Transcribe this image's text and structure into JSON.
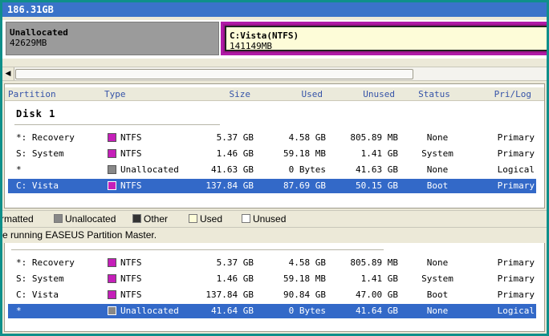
{
  "disk_map": {
    "capacity": "186.31GB",
    "segments": [
      {
        "name": "Unallocated",
        "size": "42629MB"
      },
      {
        "name": "C:Vista(NTFS)",
        "size": "141149MB"
      }
    ]
  },
  "table": {
    "columns": [
      "Partition",
      "Type",
      "Size",
      "Used",
      "Unused",
      "Status",
      "Pri/Log"
    ],
    "disk_label": "Disk 1",
    "rows": [
      {
        "partition": "*: Recovery",
        "type": "NTFS",
        "size": "5.37 GB",
        "used": "4.58 GB",
        "unused": "805.89 MB",
        "status": "None",
        "prilog": "Primary",
        "color": "#c51fb9"
      },
      {
        "partition": "S: System",
        "type": "NTFS",
        "size": "1.46 GB",
        "used": "59.18 MB",
        "unused": "1.41 GB",
        "status": "System",
        "prilog": "Primary",
        "color": "#c51fb9"
      },
      {
        "partition": "*",
        "type": "Unallocated",
        "size": "41.63 GB",
        "used": "0 Bytes",
        "unused": "41.63 GB",
        "status": "None",
        "prilog": "Logical",
        "color": "#888888"
      },
      {
        "partition": "C: Vista",
        "type": "NTFS",
        "size": "137.84 GB",
        "used": "87.69 GB",
        "unused": "50.15 GB",
        "status": "Boot",
        "prilog": "Primary",
        "color": "#c51fb9"
      }
    ]
  },
  "legend": {
    "items": [
      {
        "label": "rmatted",
        "color": ""
      },
      {
        "label": "Unallocated",
        "color": "#888888"
      },
      {
        "label": "Other",
        "color": "#333333"
      },
      {
        "label": "Used",
        "color": "#fdfcd8"
      },
      {
        "label": "Unused",
        "color": "#ffffff"
      }
    ]
  },
  "status_text": "e running EASEUS Partition Master.",
  "lower_table": {
    "rows": [
      {
        "partition": "*: Recovery",
        "type": "NTFS",
        "size": "5.37 GB",
        "used": "4.58 GB",
        "unused": "805.89 MB",
        "status": "None",
        "prilog": "Primary",
        "color": "#c51fb9"
      },
      {
        "partition": "S: System",
        "type": "NTFS",
        "size": "1.46 GB",
        "used": "59.18 MB",
        "unused": "1.41 GB",
        "status": "System",
        "prilog": "Primary",
        "color": "#c51fb9"
      },
      {
        "partition": "C: Vista",
        "type": "NTFS",
        "size": "137.84 GB",
        "used": "90.84 GB",
        "unused": "47.00 GB",
        "status": "Boot",
        "prilog": "Primary",
        "color": "#c51fb9"
      },
      {
        "partition": "*",
        "type": "Unallocated",
        "size": "41.64 GB",
        "used": "0 Bytes",
        "unused": "41.64 GB",
        "status": "None",
        "prilog": "Logical",
        "color": "#888888"
      }
    ]
  }
}
